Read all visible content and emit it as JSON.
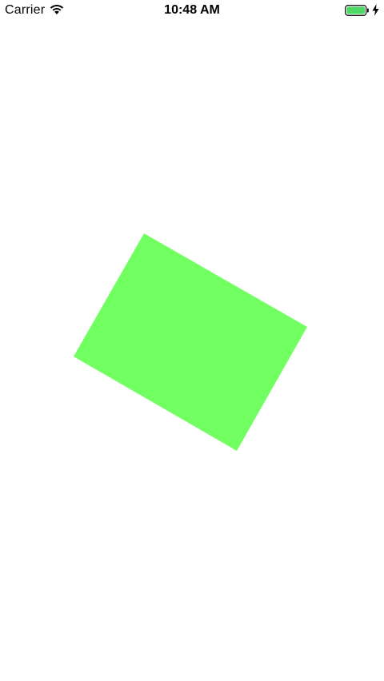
{
  "status_bar": {
    "carrier": "Carrier",
    "time": "10:48 AM",
    "wifi_icon": "wifi-icon",
    "battery_icon": "battery-icon",
    "charging_icon": "bolt-icon",
    "battery_color": "#4cd964"
  },
  "canvas": {
    "background": "#ffffff",
    "shape_color": "#72ff62"
  }
}
